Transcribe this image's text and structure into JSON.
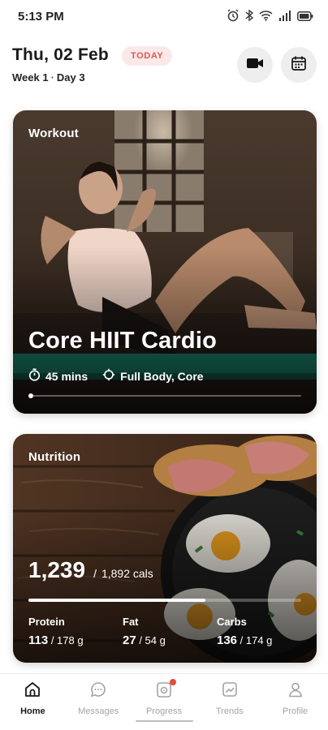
{
  "status_bar": {
    "time": "5:13 PM",
    "icons": [
      "alarm-icon",
      "bluetooth-icon",
      "wifi-icon",
      "signal-icon",
      "battery-icon"
    ]
  },
  "header": {
    "date": "Thu, 02 Feb",
    "today_badge": "TODAY",
    "week": "Week 1",
    "day": "Day 3"
  },
  "workout": {
    "label": "Workout",
    "title": "Core HIIT Cardio",
    "duration": "45 mins",
    "focus": "Full Body, Core"
  },
  "nutrition": {
    "label": "Nutrition",
    "calories": "1,239",
    "calories_goal": "1,892 cals",
    "calories_progress": 0.65,
    "macros": [
      {
        "label": "Protein",
        "value": "113",
        "goal": "/ 178 g"
      },
      {
        "label": "Fat",
        "value": "27",
        "goal": "/ 54 g"
      },
      {
        "label": "Carbs",
        "value": "136",
        "goal": "/ 174 g"
      }
    ]
  },
  "bottom_nav": [
    {
      "label": "Home",
      "icon": "home-icon",
      "active": true
    },
    {
      "label": "Messages",
      "icon": "chat-icon",
      "active": false
    },
    {
      "label": "Progress",
      "icon": "progress-icon",
      "active": false
    },
    {
      "label": "Trends",
      "icon": "trends-icon",
      "active": false
    },
    {
      "label": "Profile",
      "icon": "person-icon",
      "active": false
    }
  ],
  "colors": {
    "accent": "#e2574c",
    "badge_bg": "#fbe9e9",
    "nav_inactive": "#a3a3a3"
  }
}
